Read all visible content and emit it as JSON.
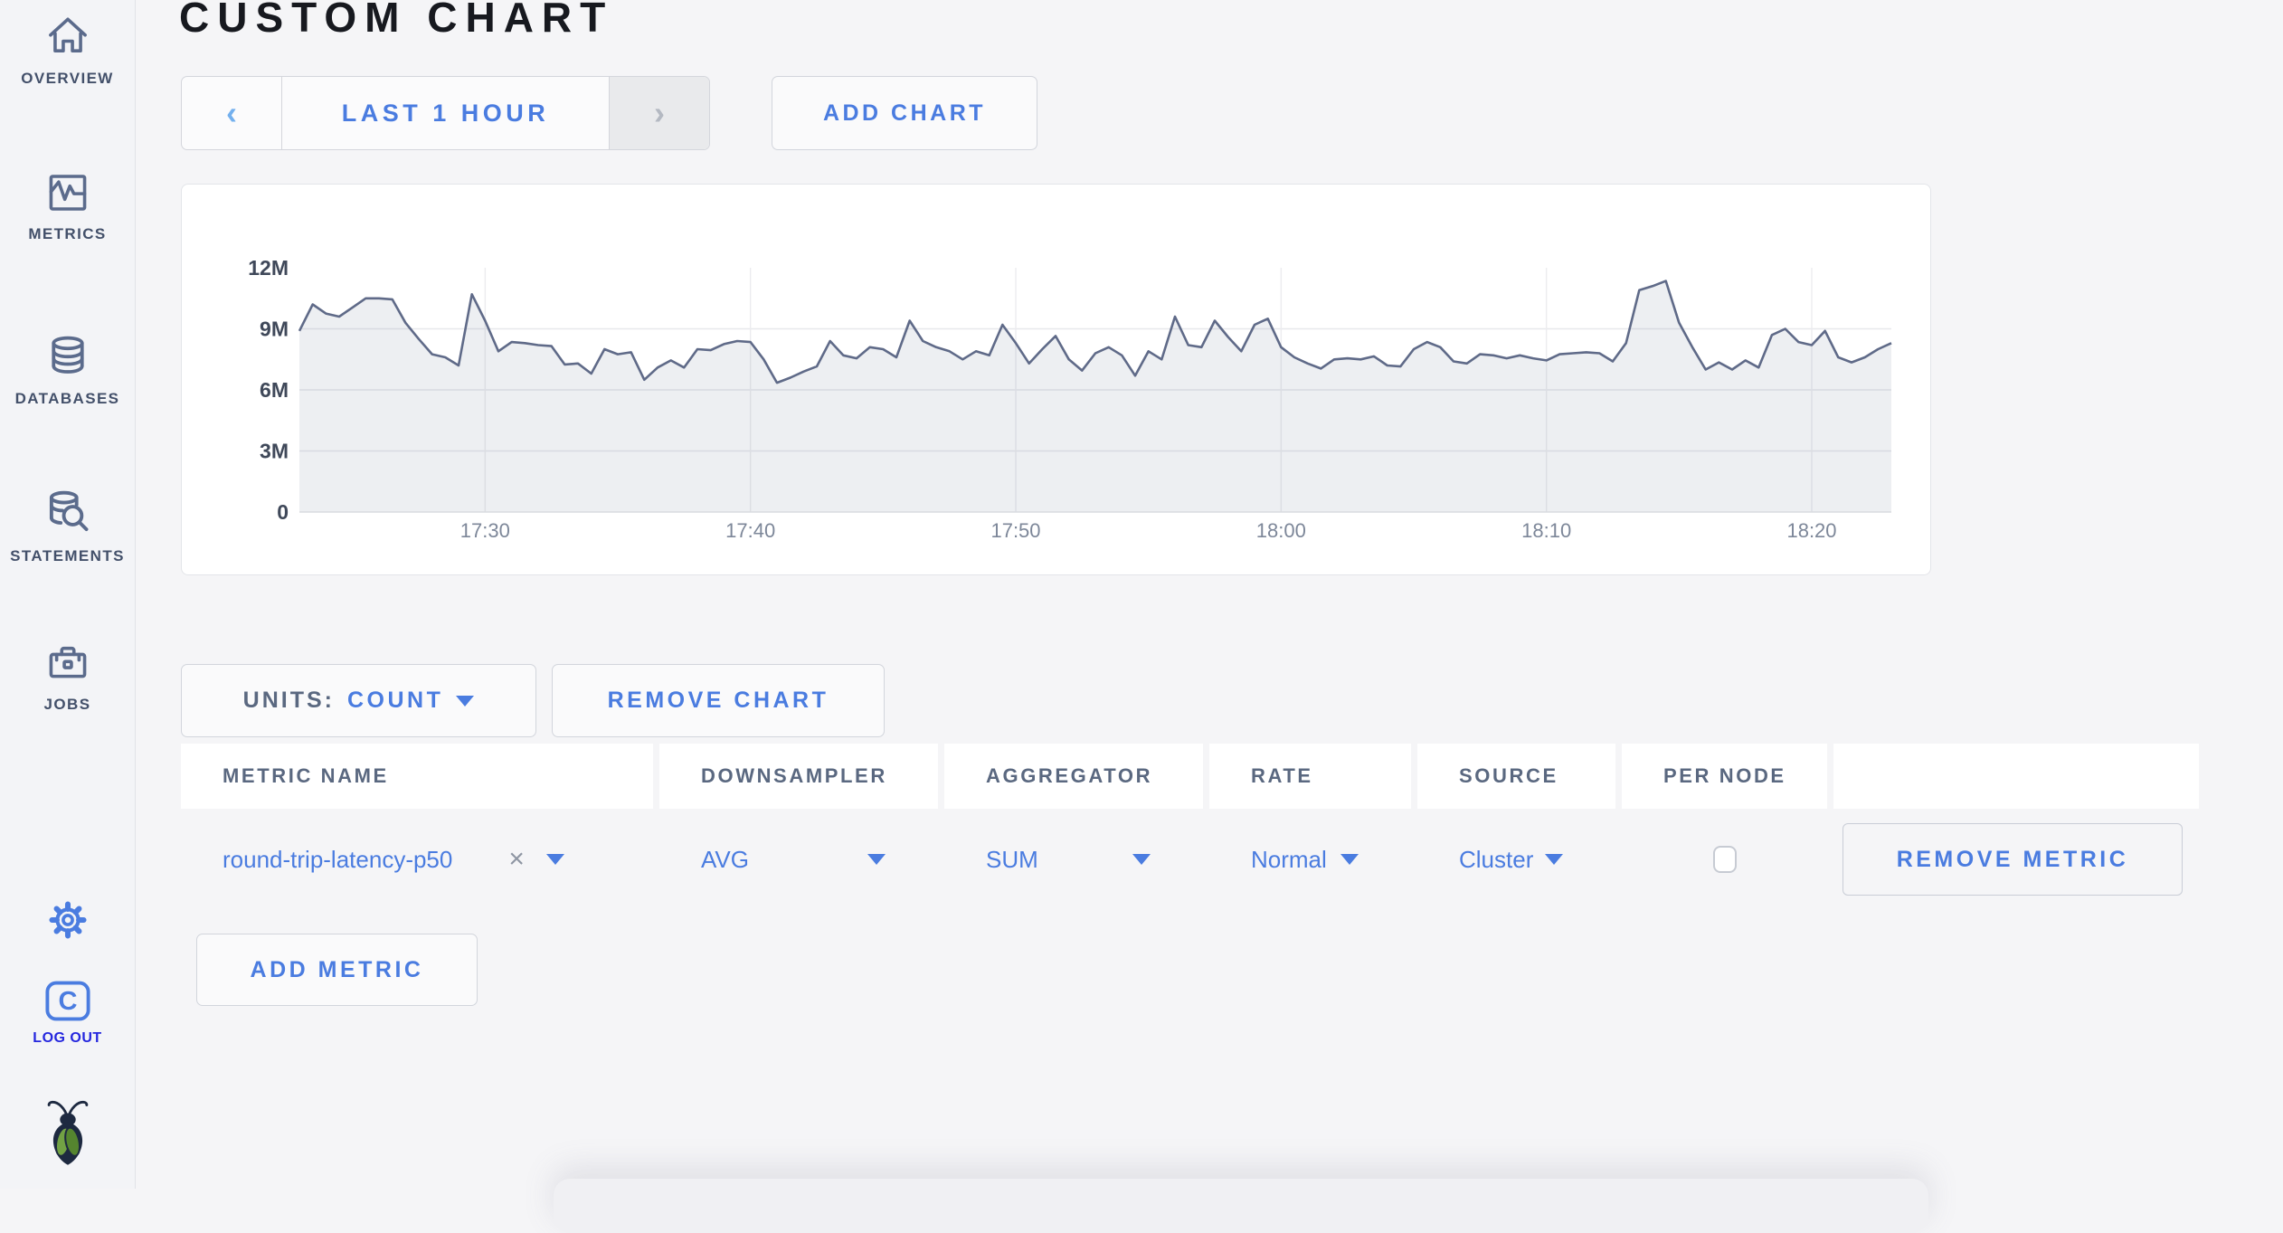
{
  "page": {
    "title": "CUSTOM CHART"
  },
  "sidebar": {
    "items": [
      {
        "label": "OVERVIEW",
        "icon": "home-icon"
      },
      {
        "label": "METRICS",
        "icon": "metrics-icon"
      },
      {
        "label": "DATABASES",
        "icon": "databases-icon"
      },
      {
        "label": "STATEMENTS",
        "icon": "statements-icon"
      },
      {
        "label": "JOBS",
        "icon": "jobs-icon"
      }
    ],
    "settings_icon": "gear-icon",
    "logout": {
      "label": "LOG OUT",
      "icon_letter": "C"
    },
    "logo": "cockroach-bug-logo"
  },
  "toolbar": {
    "prev_arrow": "‹",
    "time_range_label": "LAST 1 HOUR",
    "next_arrow": "›",
    "add_chart_label": "ADD CHART"
  },
  "chart_controls": {
    "units_label": "UNITS:",
    "units_value": "COUNT",
    "remove_chart_label": "REMOVE CHART",
    "add_metric_label": "ADD METRIC"
  },
  "metrics_table": {
    "headers": [
      "METRIC NAME",
      "DOWNSAMPLER",
      "AGGREGATOR",
      "RATE",
      "SOURCE",
      "PER NODE",
      ""
    ],
    "rows": [
      {
        "metric_name": "round-trip-latency-p50",
        "clear_glyph": "×",
        "downsampler": "AVG",
        "aggregator": "SUM",
        "rate": "Normal",
        "source": "Cluster",
        "per_node_checked": false,
        "remove_label": "REMOVE METRIC"
      }
    ]
  },
  "colors": {
    "accent_blue": "#4a7ce0",
    "light_blue_arrow": "#73b0ee",
    "slate_icon": "#5b6b8c",
    "logout_blue": "#2426de",
    "chart_line": "#5f6a88",
    "grid_line": "#e7e8ec"
  },
  "chart_data": {
    "type": "area",
    "title": "",
    "xlabel": "",
    "ylabel": "",
    "legend": "none",
    "grid": true,
    "x_start_label": "17:23",
    "x_end_label": "18:23",
    "point_interval_seconds": 30,
    "x_ticks": [
      {
        "label": "17:30",
        "offset_min": 7
      },
      {
        "label": "17:40",
        "offset_min": 17
      },
      {
        "label": "17:50",
        "offset_min": 27
      },
      {
        "label": "18:00",
        "offset_min": 37
      },
      {
        "label": "18:10",
        "offset_min": 47
      },
      {
        "label": "18:20",
        "offset_min": 57
      }
    ],
    "y_ticks": [
      {
        "label": "0",
        "value": 0
      },
      {
        "label": "3M",
        "value": 3
      },
      {
        "label": "6M",
        "value": 6
      },
      {
        "label": "9M",
        "value": 9
      },
      {
        "label": "12M",
        "value": 12
      }
    ],
    "ylim_m": [
      0,
      12
    ],
    "unit": "count",
    "value_scale": "millions",
    "series": [
      {
        "name": "round-trip-latency-p50",
        "values_m": [
          8.9,
          10.2,
          9.75,
          9.6,
          10.05,
          10.5,
          10.5,
          10.45,
          9.3,
          8.5,
          7.75,
          7.6,
          7.2,
          10.7,
          9.4,
          7.9,
          8.35,
          8.3,
          8.2,
          8.15,
          7.25,
          7.3,
          6.8,
          8.0,
          7.75,
          7.85,
          6.5,
          7.1,
          7.45,
          7.1,
          8.0,
          7.95,
          8.25,
          8.4,
          8.35,
          7.5,
          6.35,
          6.6,
          6.9,
          7.15,
          8.4,
          7.7,
          7.55,
          8.1,
          8.0,
          7.6,
          9.4,
          8.4,
          8.1,
          7.9,
          7.5,
          7.9,
          7.7,
          9.2,
          8.3,
          7.3,
          8.0,
          8.65,
          7.5,
          6.95,
          7.8,
          8.1,
          7.7,
          6.7,
          7.9,
          7.5,
          9.6,
          8.2,
          8.1,
          9.4,
          8.6,
          7.9,
          9.2,
          9.5,
          8.1,
          7.6,
          7.3,
          7.05,
          7.5,
          7.55,
          7.5,
          7.65,
          7.2,
          7.15,
          8.0,
          8.35,
          8.1,
          7.4,
          7.3,
          7.75,
          7.7,
          7.55,
          7.7,
          7.55,
          7.45,
          7.75,
          7.8,
          7.85,
          7.8,
          7.4,
          8.3,
          10.9,
          11.1,
          11.35,
          9.3,
          8.1,
          7.0,
          7.35,
          7.0,
          7.45,
          7.1,
          8.7,
          9.0,
          8.35,
          8.2,
          8.9,
          7.6,
          7.35,
          7.6,
          8.0,
          8.3
        ]
      }
    ]
  }
}
